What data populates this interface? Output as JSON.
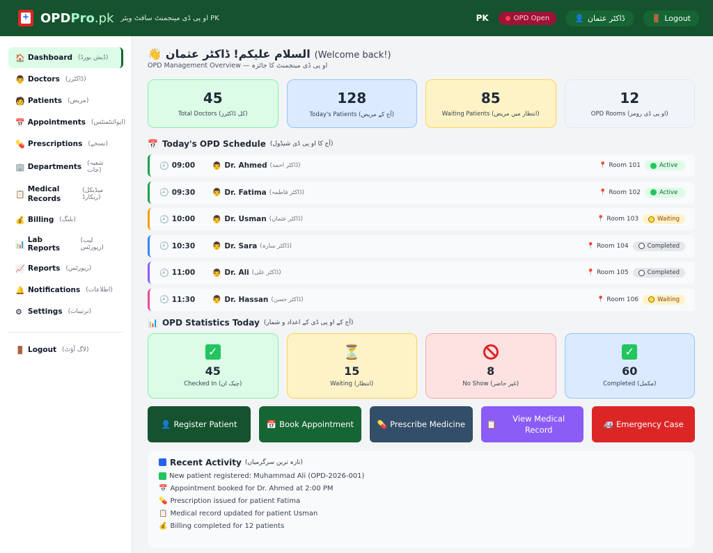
{
  "header": {
    "brand_main": "OPD",
    "brand_pro": "Pro",
    "brand_pk": ".pk",
    "tagline": "او پی ڈی مینجمنٹ سافٹ ویئر PK",
    "country": "PK",
    "status": "OPD Open",
    "user": "ڈاکٹر عثمان",
    "logout": "Logout"
  },
  "sidebar": {
    "items": [
      {
        "en": "Dashboard",
        "ur": "(ڈیش بورڈ)",
        "icon": "home-icon"
      },
      {
        "en": "Doctors",
        "ur": "(ڈاکٹرز)",
        "icon": "doctor-icon"
      },
      {
        "en": "Patients",
        "ur": "(مریض)",
        "icon": "patient-icon"
      },
      {
        "en": "Appointments",
        "ur": "(اپوائنٹمنٹس)",
        "icon": "calendar-icon"
      },
      {
        "en": "Prescriptions",
        "ur": "(نسخے)",
        "icon": "pill-icon"
      },
      {
        "en": "Departments",
        "ur": "(شعبہ جات)",
        "icon": "building-icon"
      },
      {
        "en": "Medical Records",
        "ur": "(میڈیکل ریکارڈ)",
        "icon": "clipboard-icon"
      },
      {
        "en": "Billing",
        "ur": "(بلنگ)",
        "icon": "money-bag-icon"
      },
      {
        "en": "Lab Reports",
        "ur": "(لیب رپورٹس)",
        "icon": "bar-chart-icon"
      },
      {
        "en": "Reports",
        "ur": "(رپورٹس)",
        "icon": "line-chart-icon"
      },
      {
        "en": "Notifications",
        "ur": "(اطلاعات)",
        "icon": "bell-icon"
      },
      {
        "en": "Settings",
        "ur": "(ترتیبات)",
        "icon": "gear-icon"
      }
    ],
    "logout_en": "Logout",
    "logout_ur": "(لاگ آؤٹ)"
  },
  "welcome": {
    "greet_ur": "السلام علیکم! ڈاکٹر عثمان",
    "greet_en": "(Welcome back!)",
    "subtitle": "OPD Management Overview — او پی ڈی مینجمنٹ کا جائزہ"
  },
  "stats": [
    {
      "num": "45",
      "label": "Total Doctors (کل ڈاکٹرز)"
    },
    {
      "num": "128",
      "label": "Today's Patients (آج کے مریض)"
    },
    {
      "num": "85",
      "label": "Waiting Patients (انتظار میں مریض)"
    },
    {
      "num": "12",
      "label": "OPD Rooms (او پی ڈی رومز)"
    }
  ],
  "schedule": {
    "title": "Today's OPD Schedule",
    "title_ur": "(آج کا او پی ڈی شیڈول)",
    "rows": [
      {
        "time": "09:00",
        "doc": "Dr. Ahmed",
        "doc_ur": "(ڈاکٹر احمد)",
        "room": "Room 101",
        "status": "Active",
        "color": "#16a34a"
      },
      {
        "time": "09:30",
        "doc": "Dr. Fatima",
        "doc_ur": "(ڈاکٹر فاطمہ)",
        "room": "Room 102",
        "status": "Active",
        "color": "#16a34a"
      },
      {
        "time": "10:00",
        "doc": "Dr. Usman",
        "doc_ur": "(ڈاکٹر عثمان)",
        "room": "Room 103",
        "status": "Waiting",
        "color": "#f59e0b"
      },
      {
        "time": "10:30",
        "doc": "Dr. Sara",
        "doc_ur": "(ڈاکٹر سارہ)",
        "room": "Room 104",
        "status": "Completed",
        "color": "#3b82f6"
      },
      {
        "time": "11:00",
        "doc": "Dr. Ali",
        "doc_ur": "(ڈاکٹر علی)",
        "room": "Room 105",
        "status": "Completed",
        "color": "#8b5cf6"
      },
      {
        "time": "11:30",
        "doc": "Dr. Hassan",
        "doc_ur": "(ڈاکٹر حسن)",
        "room": "Room 106",
        "status": "Waiting",
        "color": "#ec4899"
      }
    ]
  },
  "opd_stats": {
    "title": "OPD Statistics Today",
    "title_ur": "(آج کے او پی ڈی کے اعداد و شمار)",
    "cards": [
      {
        "num": "45",
        "label": "Checked In (چیک ان)"
      },
      {
        "num": "15",
        "label": "Waiting (انتظار)"
      },
      {
        "num": "8",
        "label": "No Show (غیر حاضر)"
      },
      {
        "num": "60",
        "label": "Completed (مکمل)"
      }
    ]
  },
  "actions": [
    {
      "label": "Register Patient"
    },
    {
      "label": "Book Appointment"
    },
    {
      "label": "Prescribe Medicine"
    },
    {
      "label": "View Medical Record"
    },
    {
      "label": "Emergency Case"
    }
  ],
  "activity": {
    "title": "Recent Activity",
    "title_ur": "(تازہ ترین سرگرمیاں)",
    "items": [
      "New patient registered: Muhammad Ali (OPD-2026-001)",
      "Appointment booked for Dr. Ahmed at 2:00 PM",
      "Prescription issued for patient Fatima",
      "Medical record updated for patient Usman",
      "Billing completed for 12 patients"
    ]
  }
}
